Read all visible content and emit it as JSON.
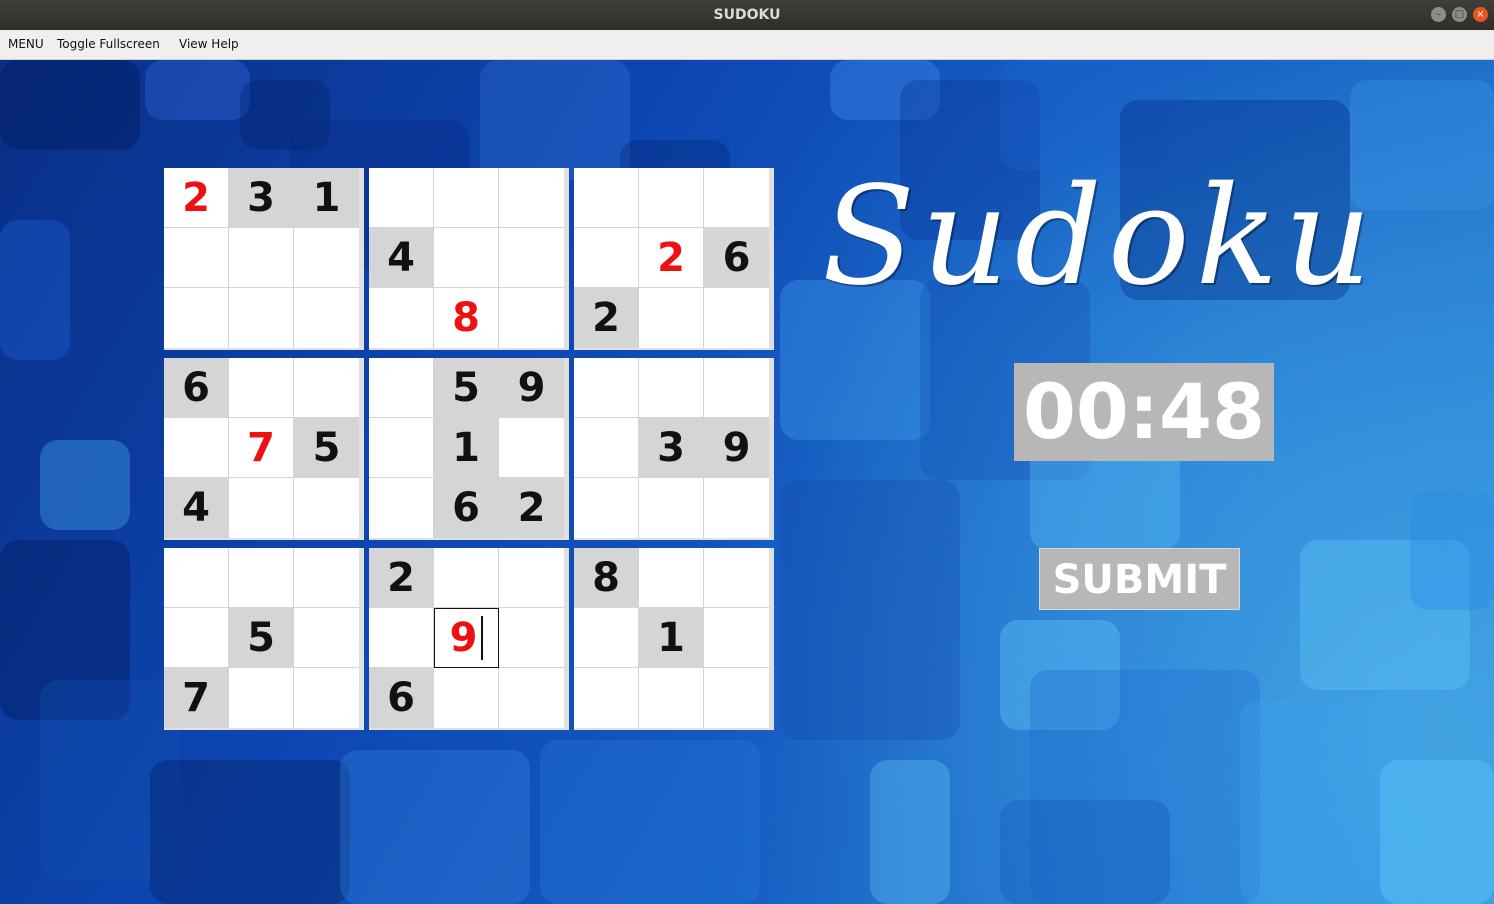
{
  "window": {
    "title": "SUDOKU",
    "controls": [
      "minimize",
      "maximize",
      "close"
    ]
  },
  "menu": {
    "items": [
      "MENU",
      "Toggle Fullscreen",
      "View Help"
    ]
  },
  "logo_text": "Sudoku",
  "timer": "00:48",
  "submit_label": "SUBMIT",
  "colors": {
    "given_cell": "#d5d5d5",
    "user_digit": "#ee1111",
    "timer_bg": "#b7b7b7"
  },
  "board": [
    [
      {
        "v": "2",
        "t": "user"
      },
      {
        "v": "3",
        "t": "given"
      },
      {
        "v": "1",
        "t": "given"
      },
      {
        "v": "",
        "t": ""
      },
      {
        "v": "",
        "t": ""
      },
      {
        "v": "",
        "t": ""
      },
      {
        "v": "",
        "t": ""
      },
      {
        "v": "",
        "t": ""
      },
      {
        "v": "",
        "t": ""
      }
    ],
    [
      {
        "v": "",
        "t": ""
      },
      {
        "v": "",
        "t": ""
      },
      {
        "v": "",
        "t": ""
      },
      {
        "v": "4",
        "t": "given"
      },
      {
        "v": "",
        "t": ""
      },
      {
        "v": "",
        "t": ""
      },
      {
        "v": "",
        "t": ""
      },
      {
        "v": "2",
        "t": "user"
      },
      {
        "v": "6",
        "t": "given"
      }
    ],
    [
      {
        "v": "",
        "t": ""
      },
      {
        "v": "",
        "t": ""
      },
      {
        "v": "",
        "t": ""
      },
      {
        "v": "",
        "t": ""
      },
      {
        "v": "8",
        "t": "user"
      },
      {
        "v": "",
        "t": ""
      },
      {
        "v": "2",
        "t": "given"
      },
      {
        "v": "",
        "t": ""
      },
      {
        "v": "",
        "t": ""
      }
    ],
    [
      {
        "v": "6",
        "t": "given"
      },
      {
        "v": "",
        "t": ""
      },
      {
        "v": "",
        "t": ""
      },
      {
        "v": "",
        "t": ""
      },
      {
        "v": "5",
        "t": "given"
      },
      {
        "v": "9",
        "t": "given"
      },
      {
        "v": "",
        "t": ""
      },
      {
        "v": "",
        "t": ""
      },
      {
        "v": "",
        "t": ""
      }
    ],
    [
      {
        "v": "",
        "t": ""
      },
      {
        "v": "7",
        "t": "user"
      },
      {
        "v": "5",
        "t": "given"
      },
      {
        "v": "",
        "t": ""
      },
      {
        "v": "1",
        "t": "given"
      },
      {
        "v": "",
        "t": ""
      },
      {
        "v": "",
        "t": ""
      },
      {
        "v": "3",
        "t": "given"
      },
      {
        "v": "9",
        "t": "given"
      }
    ],
    [
      {
        "v": "4",
        "t": "given"
      },
      {
        "v": "",
        "t": ""
      },
      {
        "v": "",
        "t": ""
      },
      {
        "v": "",
        "t": ""
      },
      {
        "v": "6",
        "t": "given"
      },
      {
        "v": "2",
        "t": "given"
      },
      {
        "v": "",
        "t": ""
      },
      {
        "v": "",
        "t": ""
      },
      {
        "v": "",
        "t": ""
      }
    ],
    [
      {
        "v": "",
        "t": ""
      },
      {
        "v": "",
        "t": ""
      },
      {
        "v": "",
        "t": ""
      },
      {
        "v": "2",
        "t": "given"
      },
      {
        "v": "",
        "t": ""
      },
      {
        "v": "",
        "t": ""
      },
      {
        "v": "8",
        "t": "given"
      },
      {
        "v": "",
        "t": ""
      },
      {
        "v": "",
        "t": ""
      }
    ],
    [
      {
        "v": "",
        "t": ""
      },
      {
        "v": "5",
        "t": "given"
      },
      {
        "v": "",
        "t": ""
      },
      {
        "v": "",
        "t": ""
      },
      {
        "v": "9",
        "t": "user-selected"
      },
      {
        "v": "",
        "t": ""
      },
      {
        "v": "",
        "t": ""
      },
      {
        "v": "1",
        "t": "given"
      },
      {
        "v": "",
        "t": ""
      }
    ],
    [
      {
        "v": "7",
        "t": "given"
      },
      {
        "v": "",
        "t": ""
      },
      {
        "v": "",
        "t": ""
      },
      {
        "v": "6",
        "t": "given"
      },
      {
        "v": "",
        "t": ""
      },
      {
        "v": "",
        "t": ""
      },
      {
        "v": "",
        "t": ""
      },
      {
        "v": "",
        "t": ""
      },
      {
        "v": "",
        "t": ""
      }
    ]
  ]
}
